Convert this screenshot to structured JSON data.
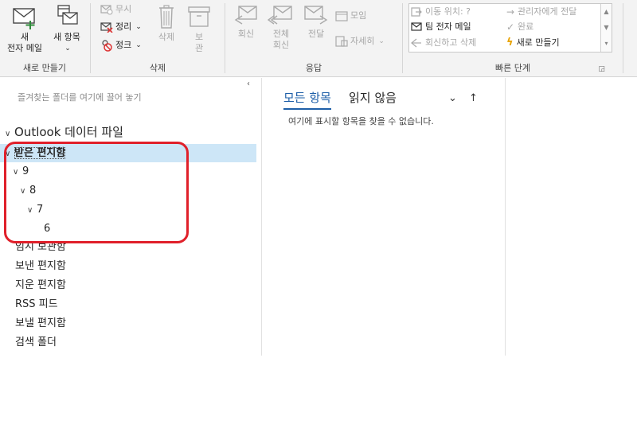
{
  "ribbon": {
    "new_group": {
      "label": "새로 만들기",
      "new_mail_line1": "새",
      "new_mail_line2": "전자 메일",
      "new_items_label": "새 항목",
      "new_items_chevron": "⌄"
    },
    "delete_group": {
      "label": "삭제",
      "ignore": "무시",
      "cleanup": "정리",
      "junk": "정크",
      "delete": "삭제",
      "archive_line1": "보",
      "archive_line2": "관"
    },
    "respond_group": {
      "label": "응답",
      "reply": "회신",
      "reply_all_line1": "전체",
      "reply_all_line2": "회신",
      "forward": "전달",
      "meeting": "모임",
      "more": "자세히"
    },
    "quick_steps_group": {
      "label": "빠른 단계",
      "items": [
        "이동 위치: ?",
        "관리자에게 전달",
        "팀 전자 메일",
        "완료",
        "회신하고 삭제",
        "새로 만들기"
      ]
    }
  },
  "folder_pane": {
    "favorites_hint": "즐겨찾는 폴더를 여기에 끌어 놓기",
    "root": "Outlook 데이터 파일",
    "inbox": "받은 편지함",
    "sub_9": "9",
    "sub_8": "8",
    "sub_7": "7",
    "sub_6": "6",
    "drafts": "임시 보관함",
    "sent": "보낸 편지함",
    "deleted": "지운 편지함",
    "rss": "RSS 피드",
    "outbox": "보낼 편지함",
    "search_folders": "검색 폴더"
  },
  "message_list": {
    "tab_all": "모든 항목",
    "tab_unread": "읽지 않음",
    "sort_chevron": "⌄",
    "sort_arrow": "↑",
    "empty_text": "여기에 표시할 항목을 찾을 수 없습니다."
  },
  "colors": {
    "accent": "#1e5fa8",
    "selection": "#cde6f7",
    "annotation_ring": "#e0202a",
    "quick_step_new": "#e8a200"
  },
  "icons": [
    "new-mail-icon",
    "new-items-icon",
    "ignore-icon",
    "cleanup-icon",
    "junk-icon",
    "delete-icon",
    "archive-icon",
    "reply-icon",
    "reply-all-icon",
    "forward-icon",
    "meeting-icon",
    "more-icon",
    "move-to-icon",
    "forward-manager-icon",
    "team-mail-icon",
    "done-icon",
    "reply-delete-icon",
    "create-new-icon"
  ]
}
